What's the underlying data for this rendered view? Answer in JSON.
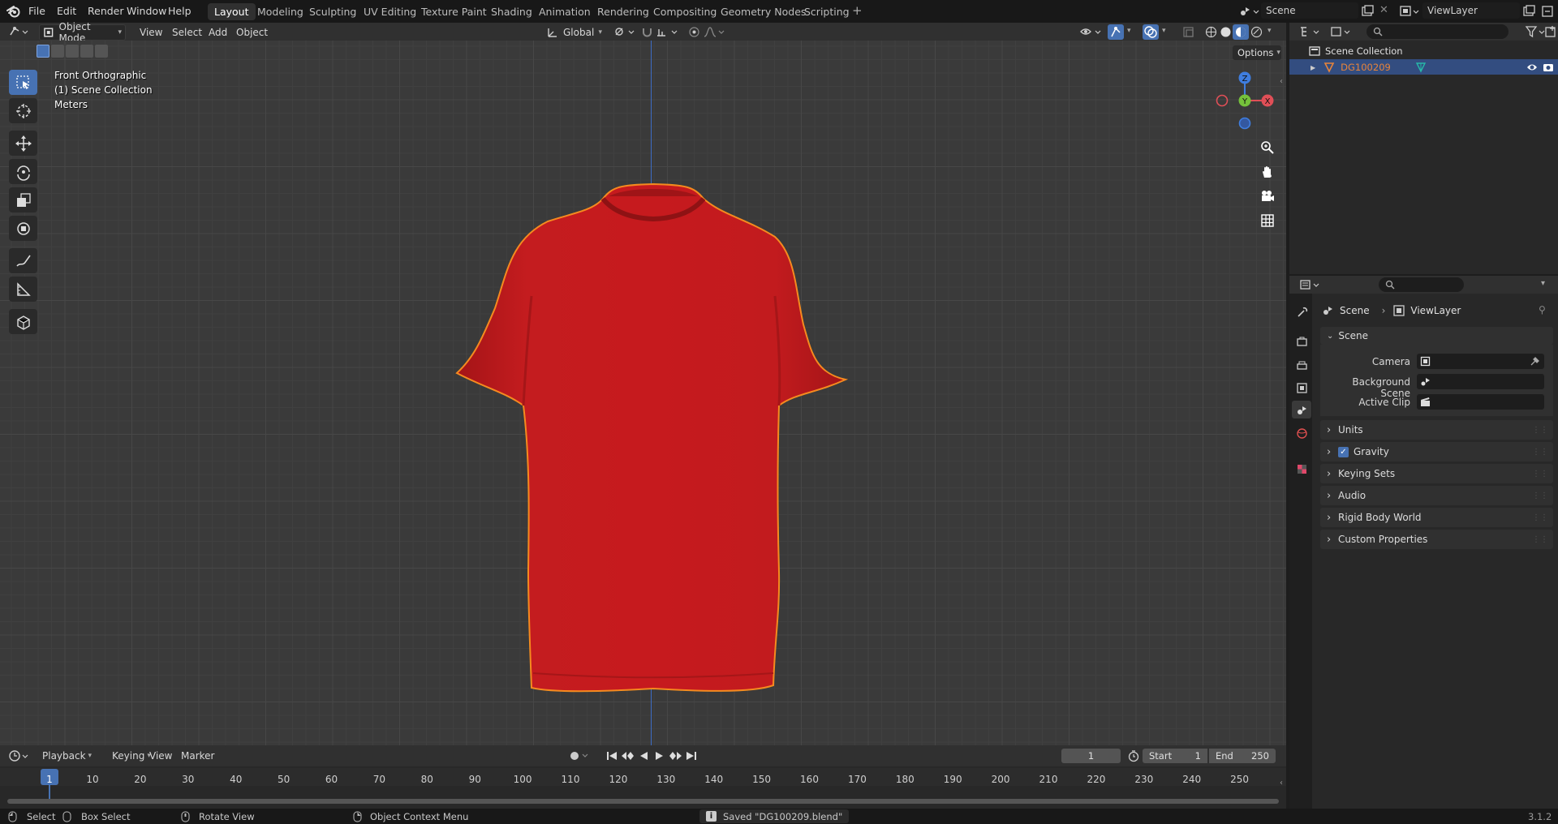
{
  "app": {
    "name": "Blender",
    "version": "3.1.2"
  },
  "menu": [
    "File",
    "Edit",
    "Render",
    "Window",
    "Help"
  ],
  "workspaces": [
    "Layout",
    "Modeling",
    "Sculpting",
    "UV Editing",
    "Texture Paint",
    "Shading",
    "Animation",
    "Rendering",
    "Compositing",
    "Geometry Nodes",
    "Scripting"
  ],
  "active_workspace": "Layout",
  "scene_field": "Scene",
  "viewlayer_field": "ViewLayer",
  "viewport_header": {
    "mode": "Object Mode",
    "menus": [
      "View",
      "Select",
      "Add",
      "Object"
    ],
    "orientation": "Global",
    "options": "Options"
  },
  "viewport_overlay": {
    "view_name": "Front Orthographic",
    "collection": "(1) Scene Collection",
    "units": "Meters"
  },
  "gizmo": {
    "z": "Z",
    "y": "Y",
    "x": "X"
  },
  "outliner": {
    "root": "Scene Collection",
    "object": "DG100209"
  },
  "properties": {
    "breadcrumb_scene": "Scene",
    "breadcrumb_viewlayer": "ViewLayer",
    "section": "Scene",
    "fields": [
      {
        "label": "Camera"
      },
      {
        "label": "Background Scene"
      },
      {
        "label": "Active Clip"
      }
    ],
    "panels": [
      "Units",
      "Gravity",
      "Keying Sets",
      "Audio",
      "Rigid Body World",
      "Custom Properties"
    ],
    "gravity_checked": true
  },
  "timeline": {
    "menus": [
      "Playback",
      "Keying",
      "View",
      "Marker"
    ],
    "current_frame": "1",
    "start_label": "Start",
    "start": "1",
    "end_label": "End",
    "end": "250",
    "ruler": [
      "1",
      "10",
      "20",
      "30",
      "40",
      "50",
      "60",
      "70",
      "80",
      "90",
      "100",
      "110",
      "120",
      "130",
      "140",
      "150",
      "160",
      "170",
      "180",
      "190",
      "200",
      "210",
      "220",
      "230",
      "240",
      "250"
    ]
  },
  "statusbar": {
    "select": "Select",
    "box_select": "Box Select",
    "rotate_view": "Rotate View",
    "context_menu": "Object Context Menu",
    "message": "Saved \"DG100209.blend\"",
    "version": "3.1.2"
  },
  "colors": {
    "accent": "#4772b3",
    "shirt": "#c21a1d",
    "selection_outline": "#f58a1f",
    "object_orange": "#e8843a"
  }
}
